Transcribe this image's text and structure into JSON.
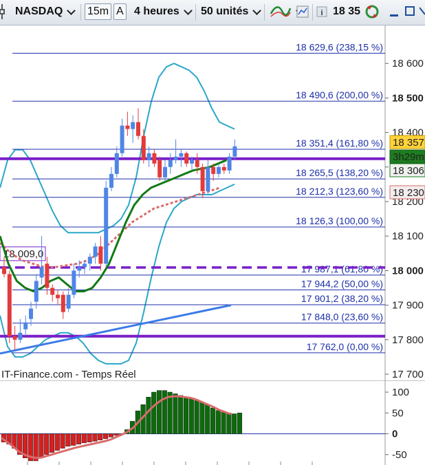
{
  "toolbar": {
    "instrument": "NASDAQ",
    "interval_button": "15m",
    "auto_button": "A",
    "period": "4 heures",
    "units": "50 unités",
    "price_readout": "18 35"
  },
  "colors": {
    "fib_line": "#1c2fa8",
    "support_line": "#7a1fc9",
    "bull_candle": "#4f86e6",
    "bear_candle": "#e23b3b",
    "bollinger": "#2aa7c9",
    "ma_green": "#0f7a13",
    "ma_dotted": "#d96b6b",
    "ma_blue": "#3b7be8",
    "osc_pos": "#0b6b0b",
    "osc_neg": "#d81f1f",
    "osc_signal": "#d96b6b"
  },
  "source_label": "IT-Finance.com - Temps Réel",
  "chart_data": [
    {
      "type": "line",
      "y_axis": {
        "ticks": [
          {
            "value": 17700,
            "label": "17 700",
            "bold": false
          },
          {
            "value": 17800,
            "label": "17 800",
            "bold": false
          },
          {
            "value": 17900,
            "label": "17 900",
            "bold": false
          },
          {
            "value": 18000,
            "label": "18 000",
            "bold": true
          },
          {
            "value": 18100,
            "label": "18 100",
            "bold": false
          },
          {
            "value": 18200,
            "label": "18 200",
            "bold": false
          },
          {
            "value": 18300,
            "label": "18 300",
            "bold": false
          },
          {
            "value": 18400,
            "label": "18 400",
            "bold": false
          },
          {
            "value": 18500,
            "label": "18 500",
            "bold": true
          },
          {
            "value": 18600,
            "label": "18 600",
            "bold": false
          }
        ]
      },
      "fib_levels": [
        {
          "value": 18629.6,
          "label": "18 629,6 (238,15 %)"
        },
        {
          "value": 18490.6,
          "label": "18 490,6 (200,00 %)"
        },
        {
          "value": 18351.4,
          "label": "18 351,4 (161,80 %)"
        },
        {
          "value": 18265.5,
          "label": "18 265,5 (138,20 %)"
        },
        {
          "value": 18212.3,
          "label": "18 212,3 (123,60 %)"
        },
        {
          "value": 18126.3,
          "label": "18 126,3 (100,00 %)"
        },
        {
          "value": 17987.1,
          "label": "17 987,1 (61,80 %)"
        },
        {
          "value": 17944.2,
          "label": "17 944,2 (50,00 %)"
        },
        {
          "value": 17901.2,
          "label": "17 901,2 (38,20 %)"
        },
        {
          "value": 17848.0,
          "label": "17 848,0 (23,60 %)"
        },
        {
          "value": 17762.0,
          "label": "17 762,0 (0,00 %)"
        }
      ],
      "horizontal_lines": [
        {
          "value": 18324,
          "style": "solid"
        },
        {
          "value": 18009,
          "style": "dashed",
          "label": "18 009,0"
        },
        {
          "value": 17810,
          "style": "solid"
        }
      ],
      "price_tags": [
        {
          "label": "18 357",
          "style": "yellow"
        },
        {
          "label": "3h29m",
          "style": "green"
        },
        {
          "label": "18 306",
          "style": "gray-green"
        },
        {
          "label": "18 230",
          "style": "gray-red"
        }
      ],
      "candles": [
        {
          "o": 18010,
          "h": 18040,
          "l": 17980,
          "c": 17990
        },
        {
          "o": 17990,
          "h": 18000,
          "l": 17790,
          "c": 17810
        },
        {
          "o": 17810,
          "h": 17840,
          "l": 17770,
          "c": 17800
        },
        {
          "o": 17800,
          "h": 17860,
          "l": 17790,
          "c": 17820
        },
        {
          "o": 17830,
          "h": 17870,
          "l": 17810,
          "c": 17850
        },
        {
          "o": 17860,
          "h": 17910,
          "l": 17840,
          "c": 17890
        },
        {
          "o": 17910,
          "h": 17990,
          "l": 17890,
          "c": 17970
        },
        {
          "o": 17980,
          "h": 18100,
          "l": 17960,
          "c": 18010
        },
        {
          "o": 18020,
          "h": 18040,
          "l": 17930,
          "c": 17950
        },
        {
          "o": 17950,
          "h": 17960,
          "l": 17910,
          "c": 17930
        },
        {
          "o": 17930,
          "h": 17945,
          "l": 17900,
          "c": 17920
        },
        {
          "o": 17930,
          "h": 17940,
          "l": 17860,
          "c": 17880
        },
        {
          "o": 17890,
          "h": 17950,
          "l": 17880,
          "c": 17930
        },
        {
          "o": 17930,
          "h": 18020,
          "l": 17920,
          "c": 18000
        },
        {
          "o": 18000,
          "h": 18030,
          "l": 17980,
          "c": 18010
        },
        {
          "o": 18010,
          "h": 18030,
          "l": 17990,
          "c": 18020
        },
        {
          "o": 18020,
          "h": 18050,
          "l": 18000,
          "c": 18040
        },
        {
          "o": 18040,
          "h": 18080,
          "l": 18020,
          "c": 18070
        },
        {
          "o": 18070,
          "h": 18100,
          "l": 18000,
          "c": 18020
        },
        {
          "o": 18020,
          "h": 18260,
          "l": 18010,
          "c": 18240
        },
        {
          "o": 18240,
          "h": 18300,
          "l": 18230,
          "c": 18280
        },
        {
          "o": 18280,
          "h": 18360,
          "l": 18270,
          "c": 18340
        },
        {
          "o": 18340,
          "h": 18440,
          "l": 18330,
          "c": 18420
        },
        {
          "o": 18420,
          "h": 18460,
          "l": 18390,
          "c": 18410
        },
        {
          "o": 18410,
          "h": 18450,
          "l": 18370,
          "c": 18430
        },
        {
          "o": 18430,
          "h": 18470,
          "l": 18380,
          "c": 18390
        },
        {
          "o": 18390,
          "h": 18410,
          "l": 18310,
          "c": 18320
        },
        {
          "o": 18320,
          "h": 18360,
          "l": 18300,
          "c": 18340
        },
        {
          "o": 18340,
          "h": 18350,
          "l": 18300,
          "c": 18310
        },
        {
          "o": 18320,
          "h": 18330,
          "l": 18260,
          "c": 18270
        },
        {
          "o": 18270,
          "h": 18320,
          "l": 18260,
          "c": 18300
        },
        {
          "o": 18300,
          "h": 18340,
          "l": 18280,
          "c": 18320
        },
        {
          "o": 18320,
          "h": 18380,
          "l": 18310,
          "c": 18330
        },
        {
          "o": 18330,
          "h": 18350,
          "l": 18300,
          "c": 18340
        },
        {
          "o": 18340,
          "h": 18345,
          "l": 18300,
          "c": 18310
        },
        {
          "o": 18310,
          "h": 18330,
          "l": 18290,
          "c": 18320
        },
        {
          "o": 18320,
          "h": 18340,
          "l": 18280,
          "c": 18300
        },
        {
          "o": 18300,
          "h": 18310,
          "l": 18210,
          "c": 18230
        },
        {
          "o": 18230,
          "h": 18320,
          "l": 18220,
          "c": 18300
        },
        {
          "o": 18300,
          "h": 18310,
          "l": 18260,
          "c": 18280
        },
        {
          "o": 18280,
          "h": 18310,
          "l": 18270,
          "c": 18300
        },
        {
          "o": 18300,
          "h": 18310,
          "l": 18280,
          "c": 18290
        },
        {
          "o": 18290,
          "h": 18340,
          "l": 18280,
          "c": 18330
        },
        {
          "o": 18330,
          "h": 18380,
          "l": 18320,
          "c": 18360
        }
      ],
      "bollinger_upper": [
        18240,
        18320,
        18350,
        18350,
        18320,
        18270,
        18220,
        18170,
        18130,
        18110,
        18110,
        18110,
        18110,
        18110,
        18120,
        18130,
        18150,
        18190,
        18270,
        18390,
        18490,
        18560,
        18590,
        18600,
        18590,
        18580,
        18560,
        18520,
        18470,
        18430,
        18420,
        18410
      ],
      "bollinger_lower": [
        17870,
        17780,
        17750,
        17750,
        17760,
        17780,
        17800,
        17810,
        17820,
        17820,
        17810,
        17790,
        17760,
        17740,
        17730,
        17730,
        17730,
        17740,
        17790,
        17880,
        17980,
        18070,
        18140,
        18180,
        18200,
        18210,
        18220,
        18220,
        18220,
        18230,
        18240,
        18250
      ],
      "ma_green": [
        18100,
        18020,
        17970,
        17950,
        17940,
        17950,
        17970,
        17980,
        17960,
        17940,
        17940,
        17950,
        17980,
        18020,
        18080,
        18140,
        18190,
        18220,
        18240,
        18250,
        18260,
        18270,
        18280,
        18290,
        18295,
        18300,
        18310,
        18320
      ],
      "ma_dotted": [
        18080,
        18050,
        18030,
        18020,
        18010,
        18010,
        18015,
        18020,
        18030,
        18050,
        18080,
        18110,
        18140,
        18160,
        18180,
        18190,
        18200,
        18210,
        18220,
        18230,
        18240
      ],
      "ma_blue": [
        17760,
        17770,
        17780,
        17790,
        17800,
        17810,
        17820,
        17830,
        17840,
        17850,
        17860,
        17870,
        17880,
        17890,
        17900
      ]
    },
    {
      "type": "bar",
      "title": "",
      "ylim": [
        -75,
        110
      ],
      "y_ticks": [
        {
          "value": 100,
          "label": "100"
        },
        {
          "value": 50,
          "label": "50"
        },
        {
          "value": 0,
          "label": "0"
        },
        {
          "value": -50,
          "label": "-50"
        }
      ],
      "values": [
        -20,
        -25,
        -35,
        -50,
        -58,
        -65,
        -65,
        -55,
        -50,
        -45,
        -40,
        -35,
        -30,
        -28,
        -25,
        -22,
        -20,
        -18,
        -15,
        -12,
        -8,
        -4,
        -2,
        10,
        30,
        55,
        70,
        88,
        100,
        104,
        104,
        100,
        96,
        92,
        88,
        85,
        80,
        75,
        70,
        62,
        56,
        52,
        50,
        48,
        50
      ],
      "signal": [
        -10,
        -20,
        -30,
        -42,
        -50,
        -55,
        -58,
        -57,
        -53,
        -49,
        -45,
        -41,
        -37,
        -33,
        -30,
        -27,
        -24,
        -21,
        -18,
        -14,
        -8,
        -2,
        5,
        15,
        30,
        45,
        60,
        72,
        82,
        88,
        90,
        90,
        88,
        86,
        82,
        76,
        70,
        64,
        57,
        52,
        47
      ]
    }
  ]
}
